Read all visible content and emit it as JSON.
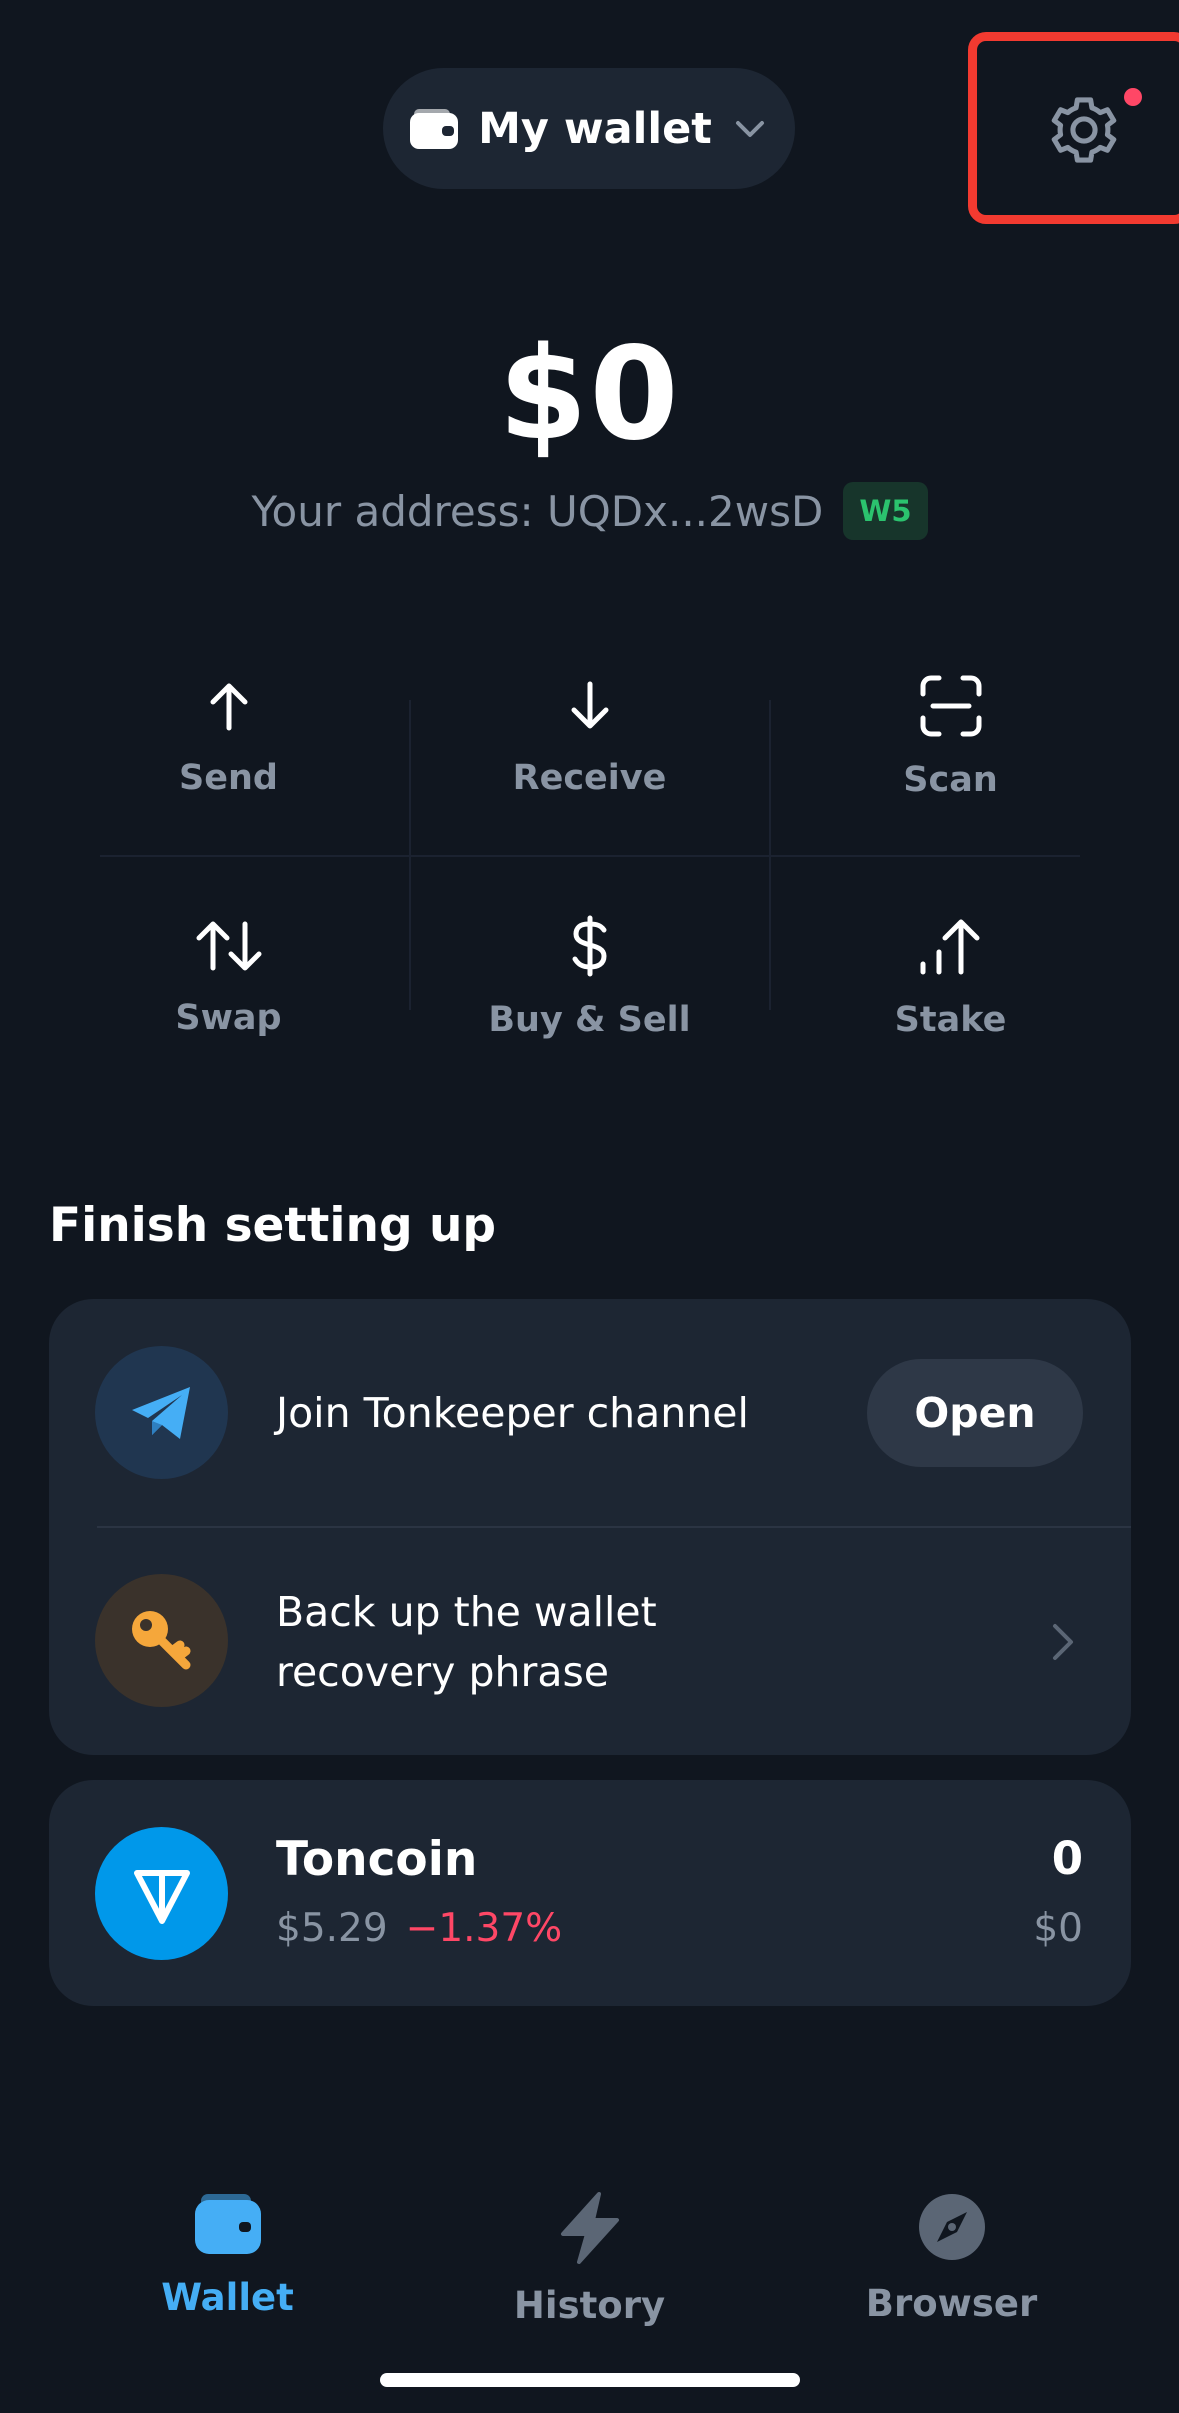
{
  "header": {
    "wallet_title": "My wallet",
    "wallet_icon": "wallet-icon",
    "chevron_icon": "chevron-down-icon",
    "settings_icon": "gear-icon"
  },
  "balance": {
    "amount": "$0",
    "address_text": "Your address: UQDx...2wsD",
    "version_badge": "W5"
  },
  "actions": [
    {
      "label": "Send",
      "icon": "arrow-up-icon"
    },
    {
      "label": "Receive",
      "icon": "arrow-down-icon"
    },
    {
      "label": "Scan",
      "icon": "scan-icon"
    },
    {
      "label": "Swap",
      "icon": "swap-icon"
    },
    {
      "label": "Buy & Sell",
      "icon": "dollar-icon"
    },
    {
      "label": "Stake",
      "icon": "stake-icon"
    }
  ],
  "setup": {
    "title": "Finish setting up",
    "items": [
      {
        "text": "Join Tonkeeper channel",
        "button": "Open",
        "icon": "telegram-icon"
      },
      {
        "text_line1": "Back up the wallet",
        "text_line2": "recovery phrase",
        "icon": "key-icon"
      }
    ]
  },
  "assets": [
    {
      "name": "Toncoin",
      "price": "$5.29",
      "change": "−1.37%",
      "amount": "0",
      "fiat": "$0",
      "icon": "toncoin-icon"
    }
  ],
  "tabs": [
    {
      "label": "Wallet",
      "icon": "wallet-tab-icon",
      "active": true
    },
    {
      "label": "History",
      "icon": "lightning-icon",
      "active": false
    },
    {
      "label": "Browser",
      "icon": "compass-icon",
      "active": false
    }
  ],
  "colors": {
    "background": "#10161F",
    "card": "#1D2633",
    "accent": "#45AEF5",
    "negative": "#FF4766",
    "positive": "#2BC26E",
    "secondary_text": "#8994A3",
    "highlight": "#F23A30"
  }
}
